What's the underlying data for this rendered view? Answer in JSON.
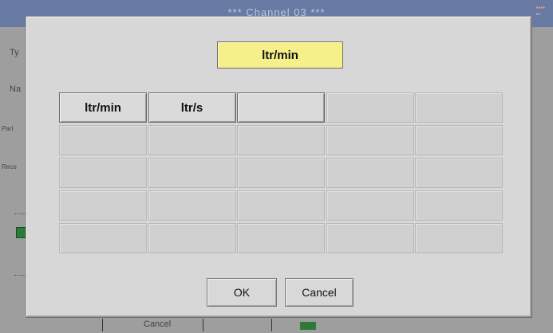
{
  "background": {
    "title": "*** Channel 03 ***",
    "side_labels": [
      "Ty",
      "Na",
      "Part",
      "Reco"
    ],
    "bottom_labels": [
      "Cancel",
      "..."
    ]
  },
  "dialog": {
    "selected_unit": "ltr/min",
    "unit_grid": [
      [
        "ltr/min",
        "ltr/s",
        "",
        "",
        ""
      ],
      [
        "",
        "",
        "",
        "",
        ""
      ],
      [
        "",
        "",
        "",
        "",
        ""
      ],
      [
        "",
        "",
        "",
        "",
        ""
      ],
      [
        "",
        "",
        "",
        "",
        ""
      ]
    ],
    "active_cells": [
      [
        0,
        0
      ],
      [
        0,
        1
      ],
      [
        0,
        2
      ]
    ],
    "ok_label": "OK",
    "cancel_label": "Cancel"
  },
  "colors": {
    "selected_unit_bg": "#f6f08b",
    "dialog_bg": "#d7d7d7",
    "titlebar_bg": "#7f8fb6"
  }
}
